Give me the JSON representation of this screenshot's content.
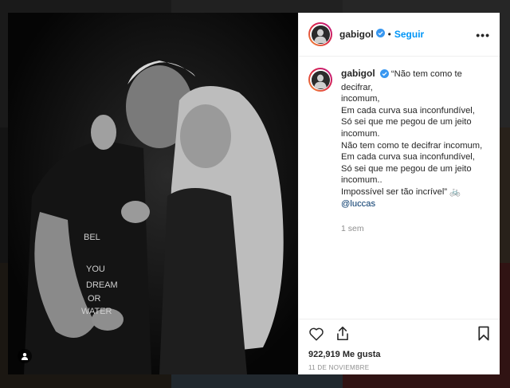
{
  "post": {
    "username": "gabigol",
    "separator": "•",
    "follow_label": "Seguir",
    "more_label": "•••",
    "caption_lines": [
      "“Não tem como te decifrar,",
      "incomum,",
      "Em cada curva sua inconfundível,",
      "Só sei que me pegou de um jeito",
      "incomum.",
      "Não tem como te decifrar incomum,",
      "Em cada curva sua inconfundível,",
      "Só sei que me pegou de um jeito",
      "incomum..",
      "Impossível ser tão incrível” 🚲"
    ],
    "mention": "@luccas",
    "time_ago": "1 sem",
    "likes": "922,919 Me gusta",
    "date": "11 DE NOVIEMBRE"
  },
  "icons": {
    "like": "heart-icon",
    "share": "share-icon",
    "save": "bookmark-icon",
    "verified": "verified-badge-icon",
    "tag": "user-tag-icon"
  },
  "colors": {
    "accent": "#0095f6",
    "text": "#262626",
    "muted": "#8e8e8e",
    "verified": "#3897f0"
  }
}
